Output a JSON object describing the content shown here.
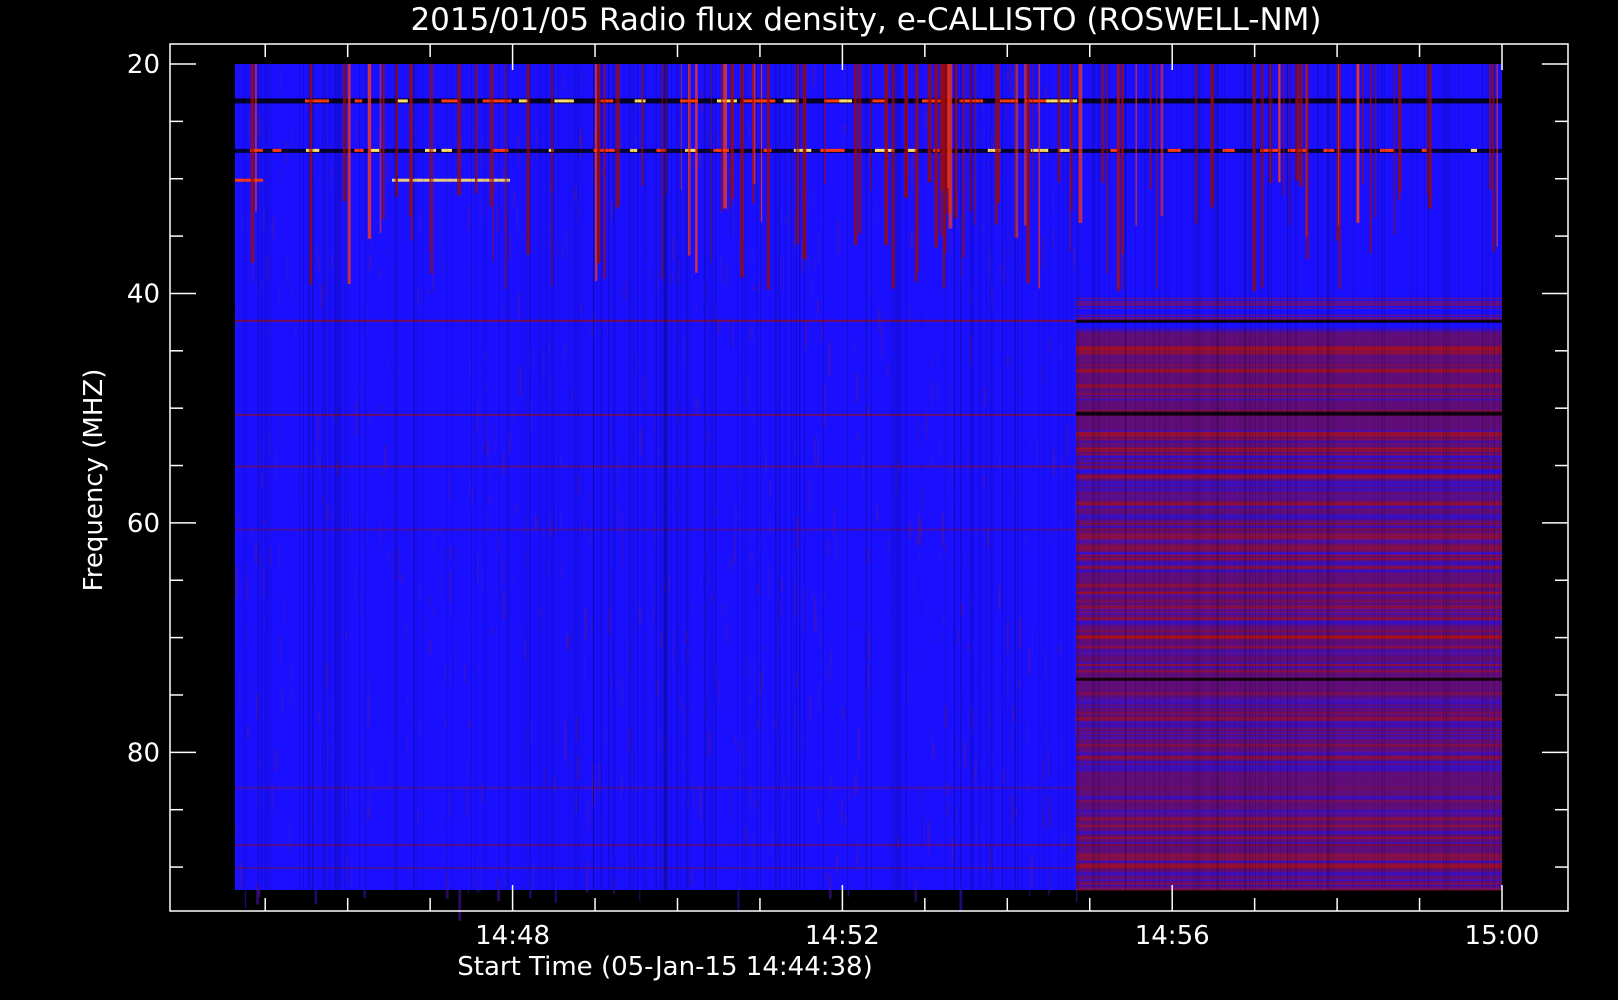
{
  "chart_data": {
    "type": "heatmap",
    "title": "2015/01/05  Radio flux density, e-CALLISTO (ROSWELL-NM)",
    "xlabel": "Start Time (05-Jan-15 14:44:38)",
    "ylabel": "Frequency (MHZ)",
    "x_ticks": [
      "14:48",
      "14:52",
      "14:56",
      "15:00"
    ],
    "y_ticks": [
      "20",
      "40",
      "60",
      "80"
    ],
    "xlim": [
      "14:44:38",
      "15:00:00"
    ],
    "ylim": [
      92,
      20
    ],
    "y_inverted": true,
    "grid": false,
    "colormap": [
      "#000000",
      "#1a10ff",
      "#9a0b0b",
      "#ff3a10",
      "#ffe066"
    ],
    "background": "#000000",
    "axis_color": "#ffffff"
  }
}
